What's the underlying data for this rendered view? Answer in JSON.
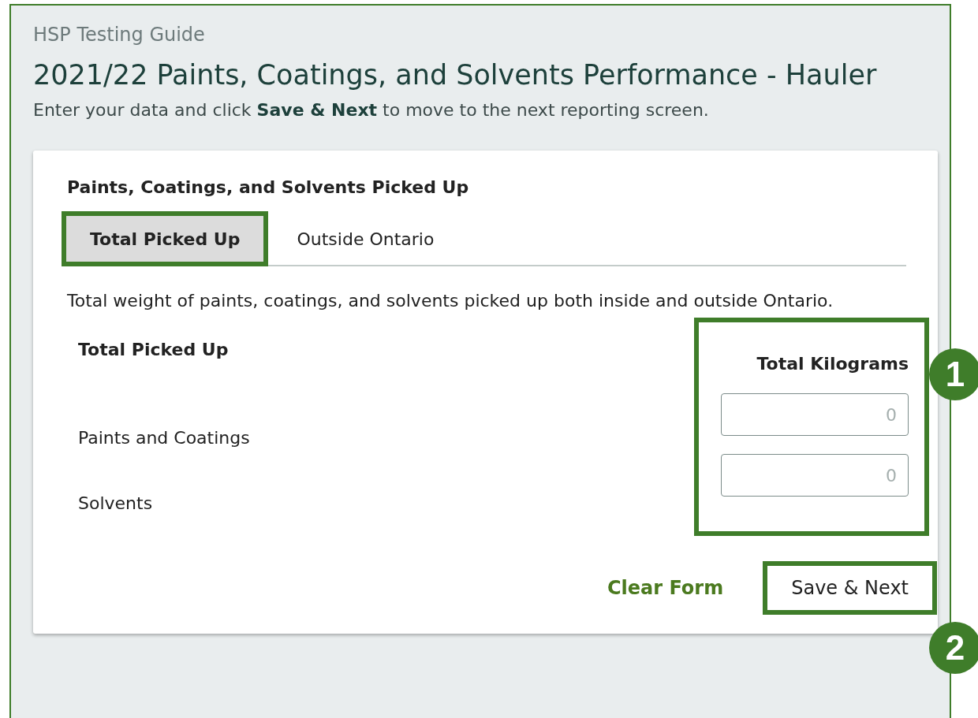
{
  "header": {
    "breadcrumb": "HSP Testing Guide",
    "title": "2021/22 Paints, Coatings, and Solvents Performance - Hauler",
    "instructions": "Enter your data and click **Save & Next** to move to the next reporting screen."
  },
  "card": {
    "title": "Paints, Coatings, and Solvents Picked Up",
    "tabs": [
      {
        "label": "Total Picked Up",
        "selected": true,
        "highlighted": true
      },
      {
        "label": "Outside Ontario",
        "selected": false,
        "highlighted": false
      }
    ],
    "description": "Total weight of paints, coatings, and solvents picked up both inside and outside Ontario.",
    "table": {
      "columns": [
        "Total Picked Up",
        "Total Kilograms"
      ],
      "highlighted": true,
      "rows": [
        {
          "label": "Paints and Coatings",
          "placeholder": "0"
        },
        {
          "label": "Solvents",
          "placeholder": "0"
        }
      ]
    },
    "actions": [
      {
        "kind": "link",
        "label": "Clear Form",
        "highlighted": false
      },
      {
        "kind": "button",
        "label": "Save & Next",
        "highlighted": true
      }
    ]
  },
  "callouts": [
    {
      "number": "1"
    },
    {
      "number": "2"
    }
  ]
}
